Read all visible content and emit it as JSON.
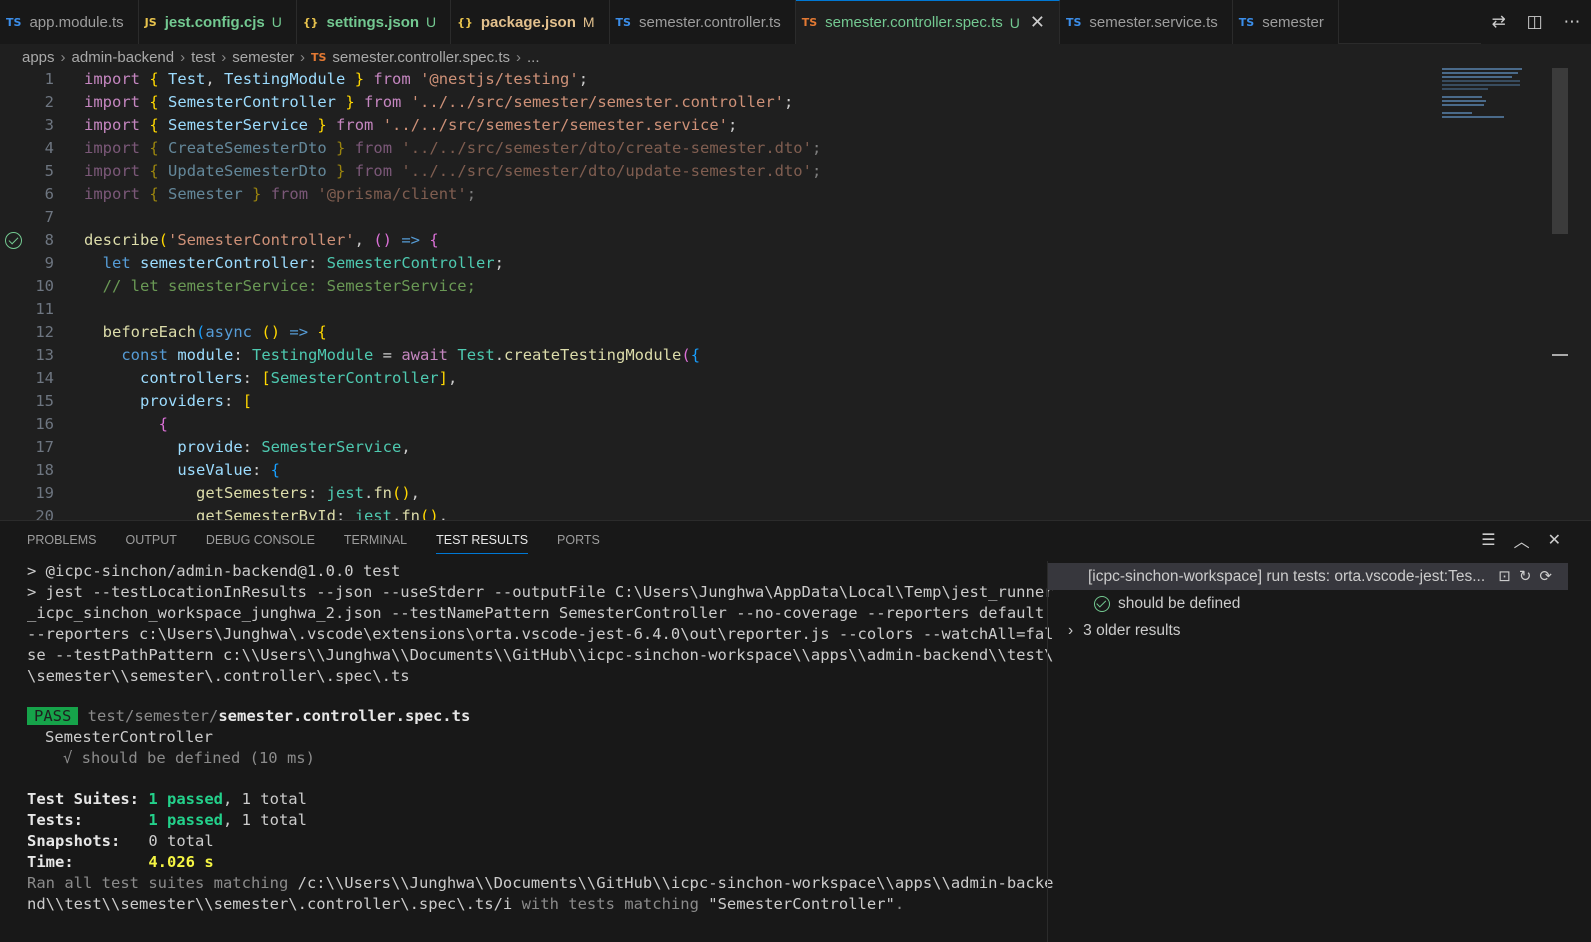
{
  "tabs": [
    {
      "icon": "TS",
      "icon_class": "ts",
      "label": "app.module.ts",
      "label_class": "plain",
      "status": "",
      "active": false
    },
    {
      "icon": "JS",
      "icon_class": "js",
      "label": "jest.config.cjs",
      "label_class": "green",
      "status": "U",
      "active": false
    },
    {
      "icon": "{}",
      "icon_class": "json",
      "label": "settings.json",
      "label_class": "green",
      "status": "U",
      "active": false
    },
    {
      "icon": "{}",
      "icon_class": "json",
      "label": "package.json",
      "label_class": "yellow",
      "status": "M",
      "active": false
    },
    {
      "icon": "TS",
      "icon_class": "ts",
      "label": "semester.controller.ts",
      "label_class": "plain",
      "status": "",
      "active": false
    },
    {
      "icon": "TS",
      "icon_class": "ts-o",
      "label": "semester.controller.spec.ts",
      "label_class": "activec",
      "status": "U",
      "active": true
    },
    {
      "icon": "TS",
      "icon_class": "ts",
      "label": "semester.service.ts",
      "label_class": "plain",
      "status": "",
      "active": false
    },
    {
      "icon": "TS",
      "icon_class": "ts",
      "label": "semester",
      "label_class": "plain",
      "status": "",
      "active": false
    }
  ],
  "breadcrumb": [
    "apps",
    "admin-backend",
    "test",
    "semester"
  ],
  "breadcrumb_file": "semester.controller.spec.ts",
  "breadcrumb_tail": "...",
  "code_lines": [
    "1",
    "2",
    "3",
    "4",
    "5",
    "6",
    "7",
    "8",
    "9",
    "10",
    "11",
    "12",
    "13",
    "14",
    "15",
    "16",
    "17",
    "18",
    "19",
    "20"
  ],
  "panel_tabs": [
    "PROBLEMS",
    "OUTPUT",
    "DEBUG CONSOLE",
    "TERMINAL",
    "TEST RESULTS",
    "PORTS"
  ],
  "terminal": {
    "l1": "> @icpc-sinchon/admin-backend@1.0.0 test",
    "l2": "> jest --testLocationInResults --json --useStderr --outputFile C:\\Users\\Junghwa\\AppData\\Local\\Temp\\jest_runner",
    "l3": "_icpc_sinchon_workspace_junghwa_2.json --testNamePattern SemesterController --no-coverage --reporters default",
    "l4": "--reporters c:\\Users\\Junghwa\\.vscode\\extensions\\orta.vscode-jest-6.4.0\\out\\reporter.js --colors --watchAll=fal",
    "l5": "se --testPathPattern c:\\\\Users\\\\Junghwa\\\\Documents\\\\GitHub\\\\icpc-sinchon-workspace\\\\apps\\\\admin-backend\\\\test\\",
    "l6": "\\semester\\\\semester\\.controller\\.spec\\.ts",
    "pass_badge": "PASS",
    "pass_dir": "test/semester/",
    "pass_file": "semester.controller.spec.ts",
    "suite": "SemesterController",
    "test_line": "√ should be defined (10 ms)",
    "suites_label": "Test Suites:",
    "suites_passed": "1 passed",
    "suites_total": ", 1 total",
    "tests_label": "Tests:",
    "tests_passed": "1 passed",
    "tests_total": ", 1 total",
    "snap_label": "Snapshots:",
    "snap_val": "0 total",
    "time_label": "Time:",
    "time_val": "4.026 s",
    "ran_a": "Ran all test suites matching ",
    "ran_b": "/c:\\\\Users\\\\Junghwa\\\\Documents\\\\GitHub\\\\icpc-sinchon-workspace\\\\apps\\\\admin-backe",
    "ran_c": "nd\\\\test\\\\semester\\\\semester\\.controller\\.spec\\.ts/i",
    "ran_d": " with tests matching ",
    "ran_e": "\"SemesterController\"",
    "ran_f": "."
  },
  "results": {
    "run": "[icpc-sinchon-workspace] run tests: orta.vscode-jest:Tes...",
    "test": "should be defined",
    "older": "3 older results"
  }
}
